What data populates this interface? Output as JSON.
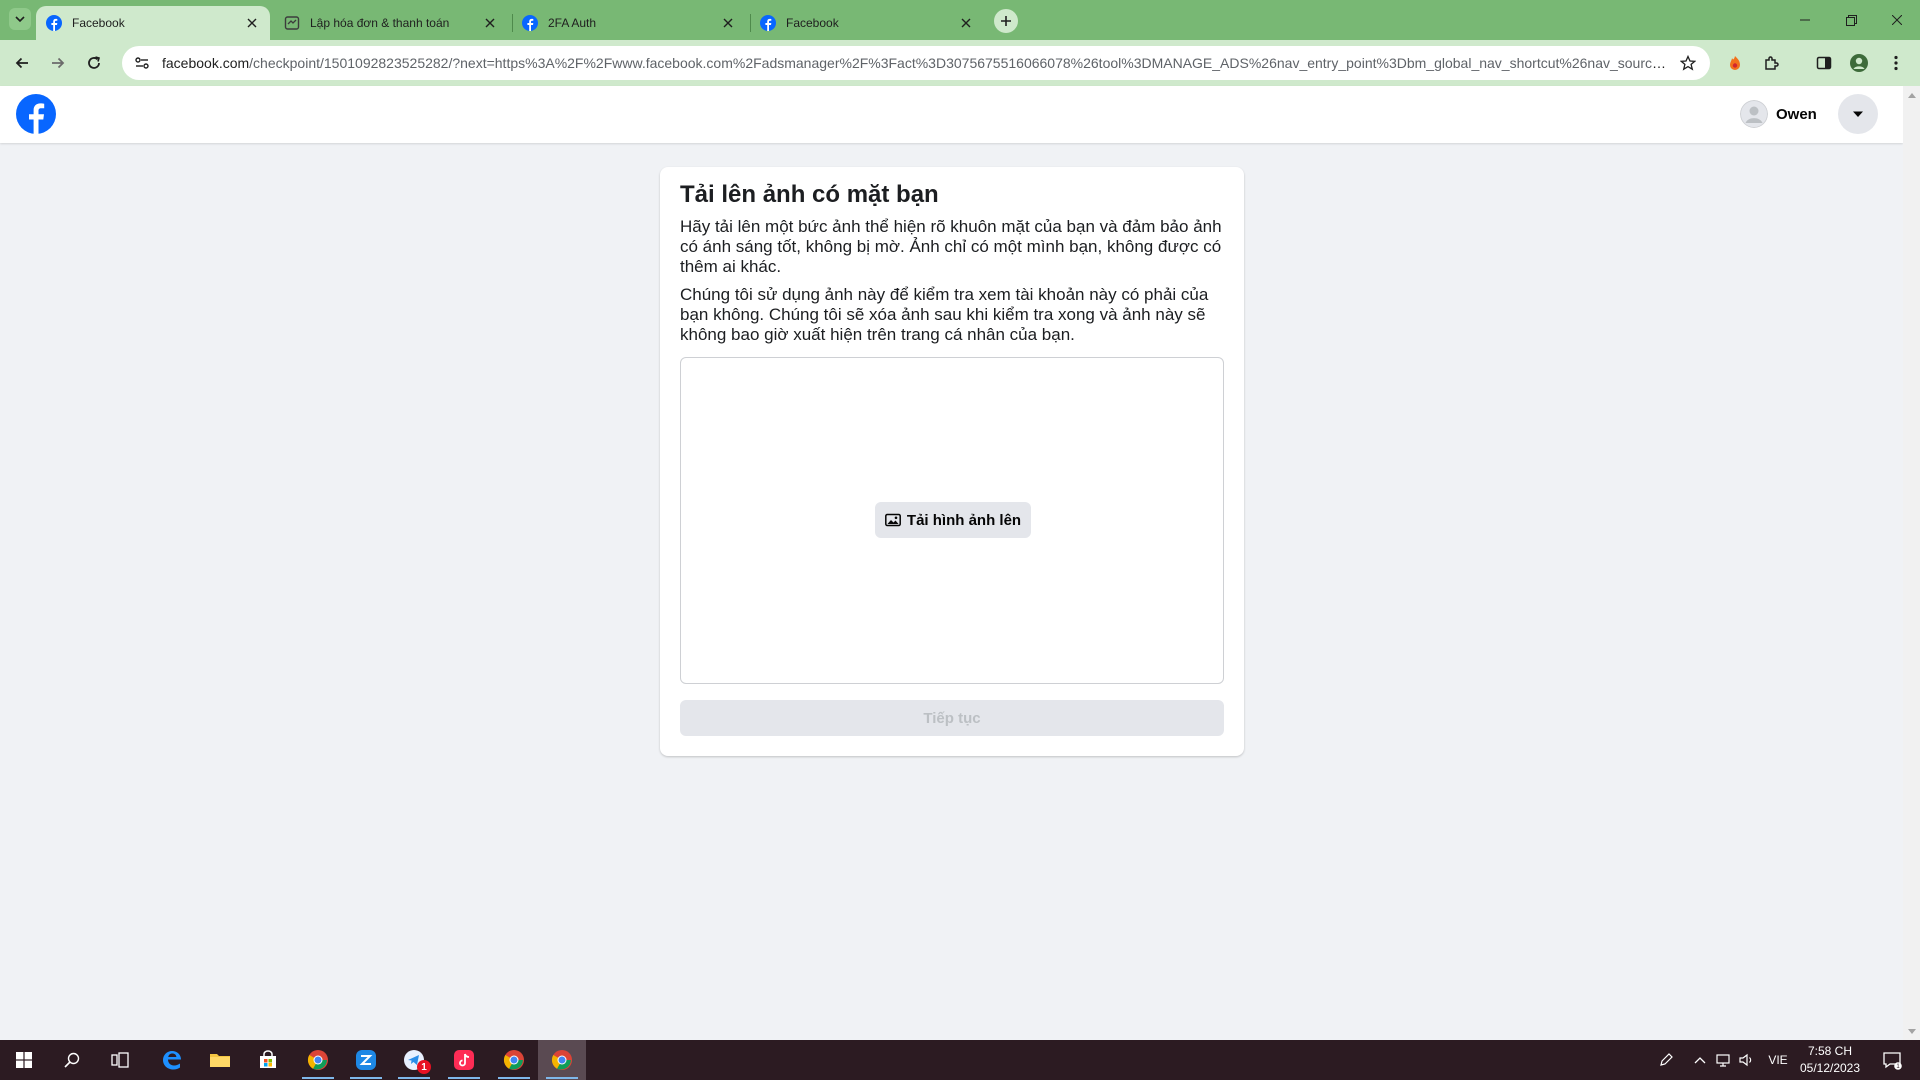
{
  "browser": {
    "tabs": [
      {
        "title": "Facebook",
        "icon": "facebook-icon",
        "active": true
      },
      {
        "title": "Lập hóa đơn & thanh toán",
        "icon": "billing-page-icon",
        "active": false
      },
      {
        "title": "2FA Auth",
        "icon": "facebook-icon",
        "active": false
      },
      {
        "title": "Facebook",
        "icon": "facebook-icon",
        "active": false
      }
    ],
    "url_host": "facebook.com",
    "url_rest": "/checkpoint/1501092823525282/?next=https%3A%2F%2Fwww.facebook.com%2Fadsmanager%2F%3Fact%3D3075675516066078%26tool%3DMANAGE_ADS%26nav_entry_point%3Dbm_global_nav_shortcut%26nav_source%3Dflyo..."
  },
  "header": {
    "user_name": "Owen"
  },
  "card": {
    "title": "Tải lên ảnh có mặt bạn",
    "paragraph1": "Hãy tải lên một bức ảnh thể hiện rõ khuôn mặt của bạn và đảm bảo ảnh có ánh sáng tốt, không bị mờ. Ảnh chỉ có một mình bạn, không được có thêm ai khác.",
    "paragraph2": "Chúng tôi sử dụng ảnh này để kiểm tra xem tài khoản này có phải của bạn không. Chúng tôi sẽ xóa ảnh sau khi kiểm tra xong và ảnh này sẽ không bao giờ xuất hiện trên trang cá nhân của bạn.",
    "upload_label": "Tải hình ảnh lên",
    "continue_label": "Tiếp tục"
  },
  "taskbar": {
    "notification_badge": "1",
    "language": "VIE",
    "time": "7:58 CH",
    "date": "05/12/2023",
    "action_center_count": "1"
  },
  "colors": {
    "facebook_blue": "#0866ff",
    "tab_strip": "#78b874",
    "toolbar": "#cfe9cc",
    "page_bg": "#f0f2f5",
    "taskbar": "#2c1b22"
  }
}
